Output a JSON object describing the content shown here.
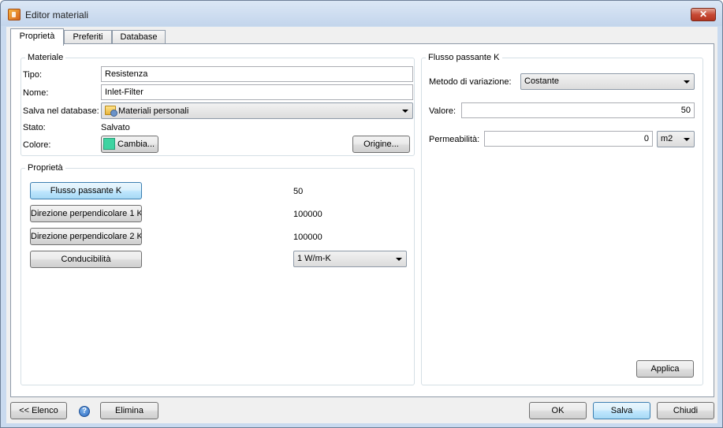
{
  "window": {
    "title": "Editor materiali",
    "close_label": "✕"
  },
  "tabs": [
    "Proprietà",
    "Preferiti",
    "Database"
  ],
  "materiale": {
    "group_title": "Materiale",
    "tipo_label": "Tipo:",
    "tipo_value": "Resistenza",
    "nome_label": "Nome:",
    "nome_value": "Inlet-Filter",
    "salva_label": "Salva nel database:",
    "salva_value": "Materiali personali",
    "stato_label": "Stato:",
    "stato_value": "Salvato",
    "colore_label": "Colore:",
    "colore_button": "Cambia...",
    "colore_swatch": "#3fd3a1",
    "origine_button": "Origine..."
  },
  "proprieta": {
    "group_title": "Proprietà",
    "rows": [
      {
        "button": "Flusso passante K",
        "value": "50"
      },
      {
        "button": "Direzione perpendicolare 1 K",
        "value": "100000"
      },
      {
        "button": "Direzione perpendicolare 2 K",
        "value": "100000"
      },
      {
        "button": "Conducibilità",
        "value": "1 W/m-K"
      }
    ]
  },
  "flusso": {
    "group_title": "Flusso passante K",
    "metodo_label": "Metodo di variazione:",
    "metodo_value": "Costante",
    "valore_label": "Valore:",
    "valore_value": "50",
    "perm_label": "Permeabilità:",
    "perm_value": "0",
    "perm_unit": "m2",
    "applica_button": "Applica"
  },
  "footer": {
    "elenco_button": "<< Elenco",
    "help_icon": "?",
    "elimina_button": "Elimina",
    "ok_button": "OK",
    "salva_button": "Salva",
    "chiudi_button": "Chiudi"
  }
}
